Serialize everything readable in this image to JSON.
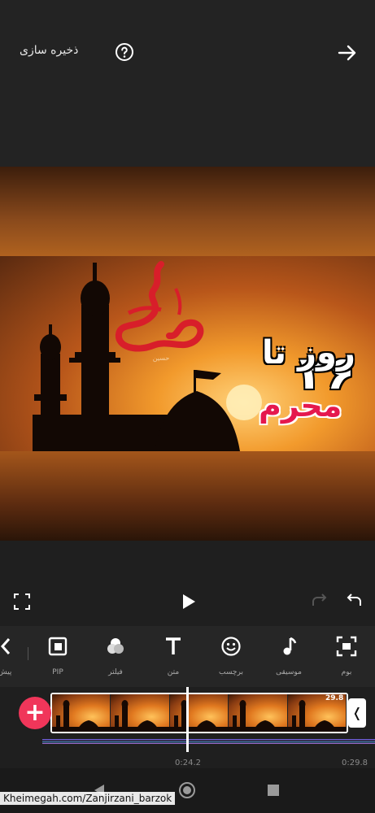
{
  "header": {
    "save_label": "ذخیره سازی"
  },
  "preview": {
    "overlay_number": "۲۶",
    "overlay_line1": "روز تا",
    "overlay_line2": "محرم",
    "calligraphy": "حسین"
  },
  "toolbar": {
    "items": [
      {
        "label": "پیش",
        "icon": "chevron-left-icon"
      },
      {
        "label": "PIP",
        "icon": "pip-icon"
      },
      {
        "label": "فیلتر",
        "icon": "filter-icon"
      },
      {
        "label": "متن",
        "icon": "text-icon"
      },
      {
        "label": "برچسب",
        "icon": "sticker-icon"
      },
      {
        "label": "موسیقی",
        "icon": "music-icon"
      },
      {
        "label": "بوم",
        "icon": "canvas-icon"
      }
    ]
  },
  "timeline": {
    "clip_duration": "29.8",
    "current_time": "0:24.2",
    "end_time": "0:29.8",
    "add_symbol": "+",
    "end_symbol": "❬"
  },
  "watermark": "Kheimegah.com/Zanjirzani_barzok",
  "colors": {
    "accent": "#f0365a",
    "overlay_red": "#e5184e",
    "background": "#1f1f1f"
  }
}
